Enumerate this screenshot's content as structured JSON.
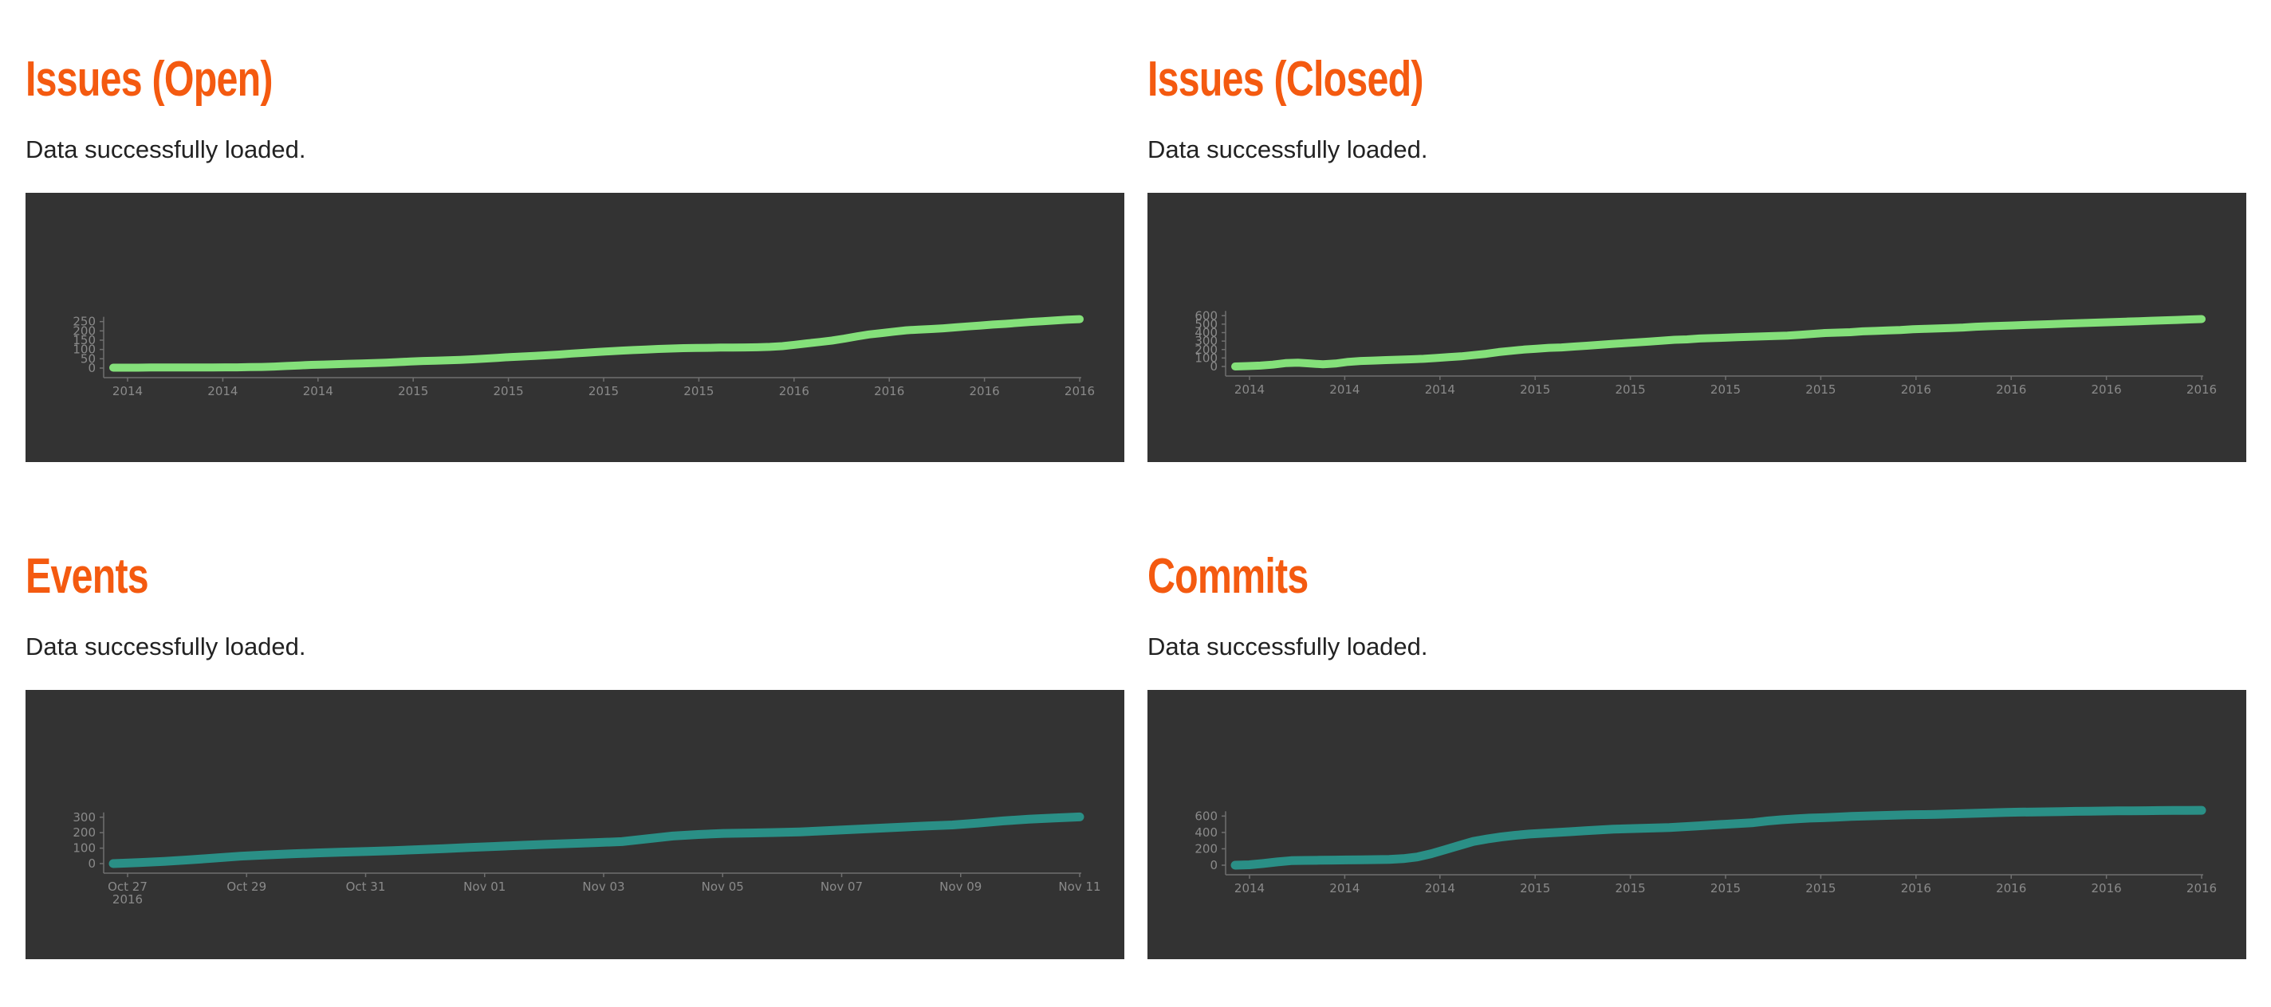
{
  "panels": [
    {
      "title": "Issues (Open)",
      "status": "Data successfully loaded.",
      "color": "#84e07a",
      "chart_data": {
        "type": "area",
        "y_ticks": [
          0,
          50,
          100,
          150,
          200,
          250
        ],
        "ylim": [
          0,
          300
        ],
        "x_ticks": [
          "2014",
          "2014",
          "2014",
          "2015",
          "2015",
          "2015",
          "2015",
          "2016",
          "2016",
          "2016",
          "2016"
        ],
        "values": [
          2,
          2,
          2,
          3,
          3,
          3,
          3,
          3,
          3,
          4,
          4,
          5,
          6,
          8,
          11,
          14,
          17,
          19,
          21,
          23,
          25,
          27,
          29,
          32,
          35,
          38,
          40,
          42,
          44,
          47,
          51,
          55,
          59,
          62,
          65,
          69,
          73,
          78,
          82,
          86,
          90,
          94,
          97,
          100,
          103,
          105,
          107,
          108,
          109,
          110,
          110,
          111,
          112,
          114,
          118,
          125,
          133,
          140,
          148,
          158,
          170,
          181,
          188,
          196,
          203,
          207,
          210,
          214,
          219,
          224,
          229,
          234,
          238,
          243,
          248,
          252,
          256,
          260,
          263
        ]
      }
    },
    {
      "title": "Issues (Closed)",
      "status": "Data successfully loaded.",
      "color": "#84e07a",
      "chart_data": {
        "type": "area",
        "y_ticks": [
          0,
          100,
          200,
          300,
          400,
          500,
          600
        ],
        "ylim": [
          0,
          640
        ],
        "x_ticks": [
          "2014",
          "2014",
          "2014",
          "2015",
          "2015",
          "2015",
          "2015",
          "2016",
          "2016",
          "2016",
          "2016"
        ],
        "values": [
          0,
          5,
          10,
          22,
          40,
          45,
          35,
          25,
          35,
          55,
          65,
          70,
          75,
          80,
          85,
          90,
          100,
          110,
          120,
          135,
          150,
          170,
          185,
          200,
          210,
          220,
          225,
          235,
          245,
          255,
          265,
          275,
          285,
          295,
          305,
          315,
          320,
          330,
          335,
          340,
          345,
          350,
          355,
          360,
          365,
          375,
          385,
          395,
          400,
          405,
          415,
          420,
          425,
          430,
          440,
          445,
          450,
          455,
          460,
          470,
          475,
          480,
          485,
          490,
          495,
          500,
          505,
          510,
          515,
          520,
          525,
          530,
          535,
          540,
          545,
          550,
          555,
          560
        ]
      }
    },
    {
      "title": "Events",
      "status": "Data successfully loaded.",
      "color": "#2a8f86",
      "chart_data": {
        "type": "line",
        "y_ticks": [
          0,
          100,
          200,
          300
        ],
        "ylim": [
          0,
          340
        ],
        "x_ticks": [
          "Oct 27",
          "Oct 29",
          "Oct 31",
          "Nov 01",
          "Nov 03",
          "Nov 05",
          "Nov 07",
          "Nov 09",
          "Nov 11"
        ],
        "x_tick_year": "2016",
        "values": [
          0,
          6,
          14,
          24,
          36,
          48,
          56,
          63,
          69,
          74,
          79,
          84,
          90,
          97,
          104,
          111,
          118,
          124,
          130,
          136,
          142,
          160,
          178,
          188,
          195,
          198,
          201,
          205,
          212,
          220,
          228,
          236,
          243,
          250,
          262,
          276,
          287,
          295,
          302
        ]
      }
    },
    {
      "title": "Commits",
      "status": "Data successfully loaded.",
      "color": "#2a8f86",
      "chart_data": {
        "type": "line",
        "y_ticks": [
          0,
          200,
          400,
          600
        ],
        "ylim": [
          0,
          720
        ],
        "x_ticks": [
          "2014",
          "2014",
          "2014",
          "2015",
          "2015",
          "2015",
          "2015",
          "2016",
          "2016",
          "2016",
          "2016"
        ],
        "values": [
          0,
          5,
          20,
          40,
          55,
          58,
          60,
          62,
          64,
          66,
          68,
          70,
          80,
          100,
          140,
          190,
          240,
          290,
          320,
          345,
          365,
          380,
          390,
          400,
          410,
          420,
          430,
          440,
          445,
          450,
          455,
          460,
          470,
          480,
          490,
          500,
          510,
          520,
          540,
          555,
          565,
          575,
          580,
          588,
          595,
          600,
          605,
          610,
          615,
          618,
          620,
          625,
          630,
          635,
          640,
          645,
          648,
          650,
          652,
          655,
          658,
          660,
          662,
          664,
          665,
          666,
          667,
          668,
          669,
          670
        ]
      }
    }
  ]
}
